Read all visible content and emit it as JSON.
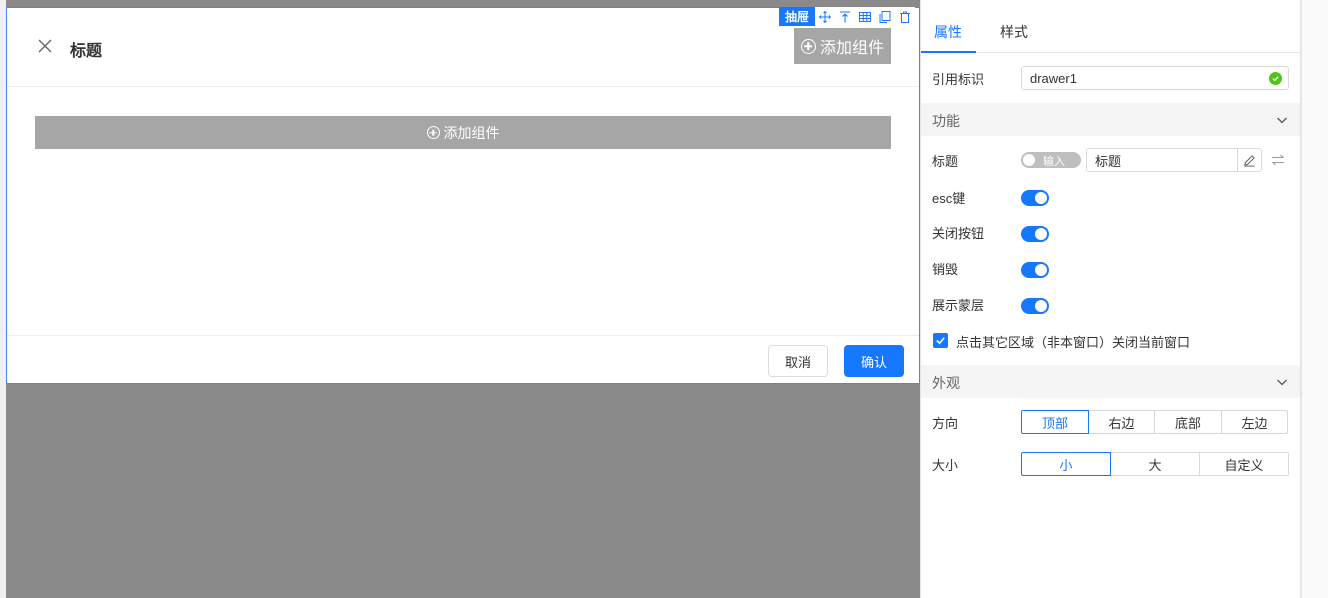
{
  "canvas": {
    "toolbar": {
      "tag_label": "抽屉"
    },
    "drawer": {
      "title": "标题",
      "header_add_label": "添加组件",
      "body_add_label": "添加组件",
      "cancel_label": "取消",
      "ok_label": "确认"
    }
  },
  "panel": {
    "tabs": [
      {
        "label": "属性",
        "active": true
      },
      {
        "label": "样式",
        "active": false
      }
    ],
    "ref": {
      "label": "引用标识",
      "value": "drawer1"
    },
    "sections": {
      "function": "功能",
      "appearance": "外观"
    },
    "title_row": {
      "label": "标题",
      "toggle_label": "输入",
      "value": "标题"
    },
    "switches": [
      {
        "label": "esc键",
        "on": true
      },
      {
        "label": "关闭按钮",
        "on": true
      },
      {
        "label": "销毁",
        "on": true
      },
      {
        "label": "展示蒙层",
        "on": true
      }
    ],
    "click_outside": {
      "label": "点击其它区域（非本窗口）关闭当前窗口",
      "checked": true
    },
    "direction": {
      "label": "方向",
      "options": [
        "顶部",
        "右边",
        "底部",
        "左边"
      ],
      "selected": "顶部"
    },
    "size": {
      "label": "大小",
      "options": [
        "小",
        "大",
        "自定义"
      ],
      "selected": "小"
    }
  },
  "colors": {
    "accent": "#1677ff",
    "success": "#52c41a",
    "placeholder_gray": "#a6a6a6",
    "canvas_mask": "#8a8a8a"
  }
}
